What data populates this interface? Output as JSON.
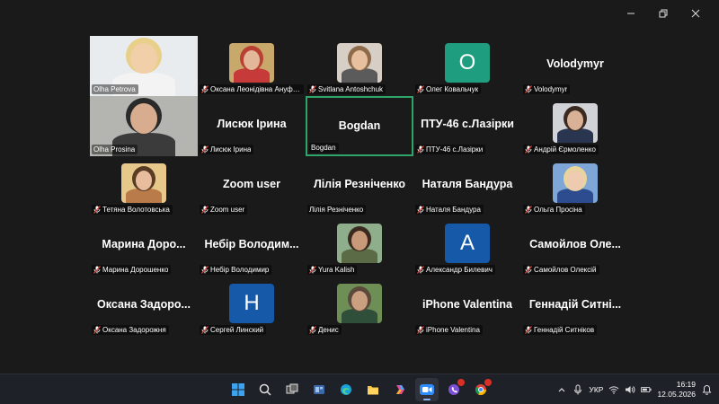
{
  "window": {
    "controls": [
      "minimize",
      "restore",
      "close"
    ]
  },
  "participants": [
    {
      "id": "p1",
      "label": "Olha Petrova",
      "big_name": "",
      "kind": "video",
      "muted": false,
      "photo": "blonde-woman-light"
    },
    {
      "id": "p2",
      "label": "Оксана Леонідівна Ануфрієва",
      "big_name": "",
      "kind": "photo",
      "muted": true,
      "photo": "older-woman-red"
    },
    {
      "id": "p3",
      "label": "Svitlana Antoshchuk",
      "big_name": "",
      "kind": "photo",
      "muted": true,
      "photo": "woman-light"
    },
    {
      "id": "p4",
      "label": "Олег Ковальчук",
      "big_name": "",
      "kind": "letter",
      "letter": "O",
      "letter_color": "#1e9e7f",
      "muted": true
    },
    {
      "id": "p5",
      "label": "Volodymyr",
      "big_name": "Volodymyr",
      "kind": "name",
      "muted": true
    },
    {
      "id": "p6",
      "label": "Olha Prosina",
      "big_name": "",
      "kind": "video",
      "muted": false,
      "photo": "woman-glasses"
    },
    {
      "id": "p7",
      "label": "Лисюк Ірина",
      "big_name": "Лисюк Ірина",
      "kind": "name",
      "muted": true
    },
    {
      "id": "p8",
      "label": "Bogdan",
      "big_name": "Bogdan",
      "kind": "name",
      "muted": false,
      "active": true
    },
    {
      "id": "p9",
      "label": "ПТУ-46 с.Лазірки",
      "big_name": "ПТУ-46 с.Лазірки",
      "kind": "name",
      "muted": true
    },
    {
      "id": "p10",
      "label": "Андрій Єрмоленко",
      "big_name": "",
      "kind": "photo",
      "muted": true,
      "photo": "man-suit"
    },
    {
      "id": "p11",
      "label": "Тетяна Волотовська",
      "big_name": "",
      "kind": "photo",
      "muted": true,
      "photo": "woman-dark-hair"
    },
    {
      "id": "p12",
      "label": "Zoom user",
      "big_name": "Zoom user",
      "kind": "name",
      "muted": true
    },
    {
      "id": "p13",
      "label": "Лілія Резніченко",
      "big_name": "Лілія Резніченко",
      "kind": "name",
      "muted": false
    },
    {
      "id": "p14",
      "label": "Наталя Бандура",
      "big_name": "Наталя Бандура",
      "kind": "name",
      "muted": true
    },
    {
      "id": "p15",
      "label": "Ольга Просіна",
      "big_name": "",
      "kind": "photo",
      "muted": true,
      "photo": "blonde-woman-blue"
    },
    {
      "id": "p16",
      "label": "Марина Дорошенко",
      "big_name": "Марина Доро...",
      "kind": "name",
      "muted": true
    },
    {
      "id": "p17",
      "label": "Небір Володимир",
      "big_name": "Небір Володим...",
      "kind": "name",
      "muted": true
    },
    {
      "id": "p18",
      "label": "Yura Kalish",
      "big_name": "",
      "kind": "photo",
      "muted": true,
      "photo": "man-outdoor"
    },
    {
      "id": "p19",
      "label": "Александр Билевич",
      "big_name": "",
      "kind": "letter",
      "letter": "A",
      "letter_color": "#1559a8",
      "muted": true
    },
    {
      "id": "p20",
      "label": "Самойлов Олексій",
      "big_name": "Самойлов Оле...",
      "kind": "name",
      "muted": true
    },
    {
      "id": "p21",
      "label": "Оксана Задорожня",
      "big_name": "Оксана Задоро...",
      "kind": "name",
      "muted": true
    },
    {
      "id": "p22",
      "label": "Сергей Линский",
      "big_name": "",
      "kind": "letter",
      "letter": "H",
      "letter_color": "#1559a8",
      "muted": true
    },
    {
      "id": "p23",
      "label": "Денис",
      "big_name": "",
      "kind": "photo",
      "muted": true,
      "photo": "man-green"
    },
    {
      "id": "p24",
      "label": "iPhone Valentina",
      "big_name": "iPhone Valentina",
      "kind": "name",
      "muted": true
    },
    {
      "id": "p25",
      "label": "Геннадій Ситніков",
      "big_name": "Геннадій Ситні...",
      "kind": "name",
      "muted": true
    }
  ],
  "taskbar": {
    "apps": [
      "windows-start",
      "search",
      "task-view",
      "widgets",
      "edge",
      "file-explorer",
      "copilot",
      "zoom",
      "viber",
      "chrome"
    ],
    "active_app": "zoom",
    "lang": "УКР",
    "time": "16:19",
    "date": "12.05.2026"
  },
  "colors": {
    "active_border": "#2ea56b",
    "mute_red": "#e0443a"
  }
}
